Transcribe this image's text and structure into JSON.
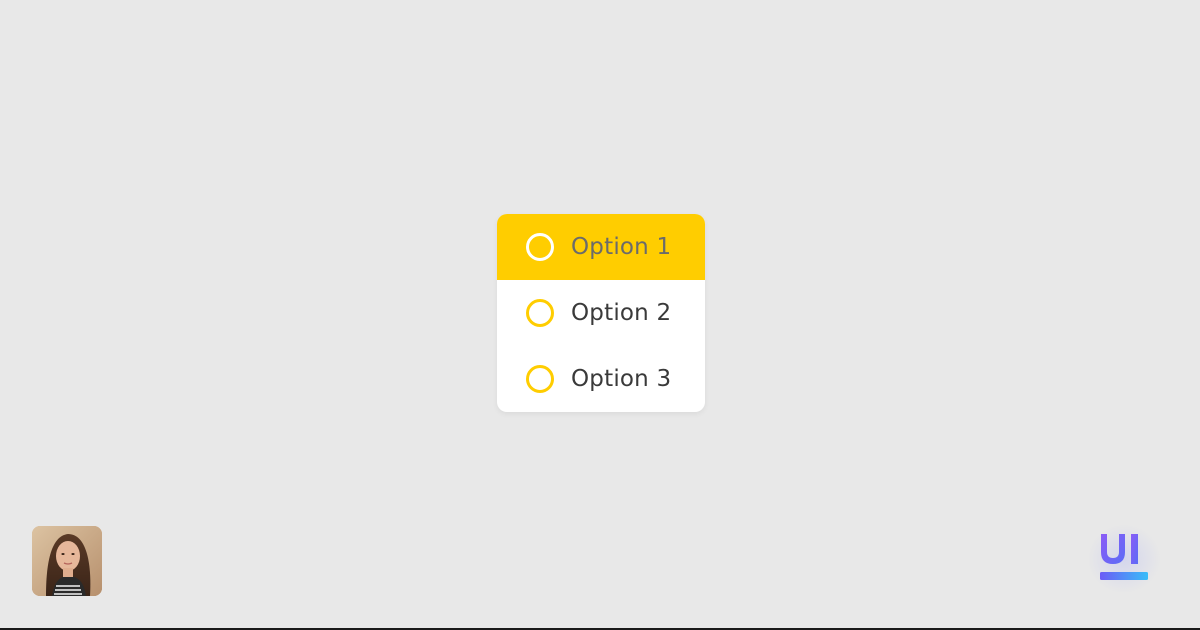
{
  "radio_group": {
    "selected_index": 0,
    "options": [
      {
        "label": "Option 1"
      },
      {
        "label": "Option 2"
      },
      {
        "label": "Option 3"
      }
    ]
  },
  "colors": {
    "background": "#e8e8e8",
    "card": "#ffffff",
    "accent": "#ffcd00",
    "text": "#3a3a3a",
    "selected_text": "#6b6b6b",
    "logo_gradient_start": "#8b5cf6",
    "logo_gradient_end": "#3b82f6",
    "logo_bar": "#38bdf8"
  },
  "icons": {
    "avatar": "user-avatar-photo",
    "brand": "ui-logo-icon"
  }
}
